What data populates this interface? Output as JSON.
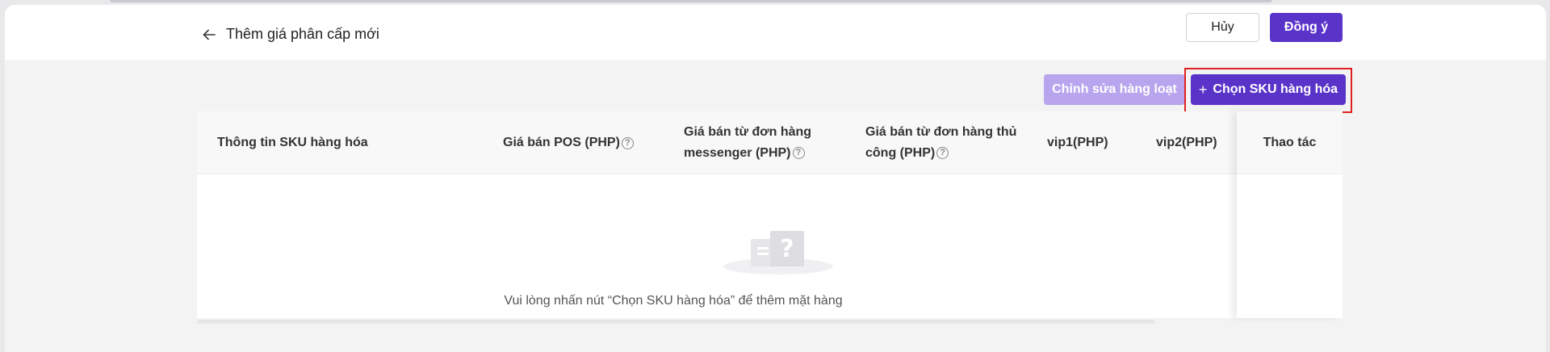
{
  "header": {
    "title": "Thêm giá phân cấp mới",
    "cancel_label": "Hủy",
    "ok_label": "Đồng ý"
  },
  "toolbar": {
    "bulk_edit_label": "Chỉnh sửa hàng loạt",
    "select_sku_label": "Chọn SKU hàng hóa",
    "select_sku_icon": "plus-icon"
  },
  "table": {
    "columns": [
      {
        "label": "Thông tin SKU hàng hóa",
        "help": false
      },
      {
        "label": "Giá bán POS (PHP)",
        "help": true
      },
      {
        "label_line1": "Giá bán từ đơn hàng",
        "label_line2": "messenger (PHP)",
        "help": true
      },
      {
        "label_line1": "Giá bán từ đơn hàng thủ",
        "label_line2": "công (PHP)",
        "help": true
      },
      {
        "label": "vip1(PHP)",
        "help": false
      },
      {
        "label": "vip2(PHP)",
        "help": false
      },
      {
        "label": "Thao tác",
        "help": false
      }
    ],
    "empty_text": "Vui lòng nhấn nút “Chọn SKU hàng hóa” để thêm mặt hàng"
  },
  "colors": {
    "primary": "#5a33c9",
    "primary_disabled": "#b8a5ee",
    "highlight": "#e02020"
  }
}
